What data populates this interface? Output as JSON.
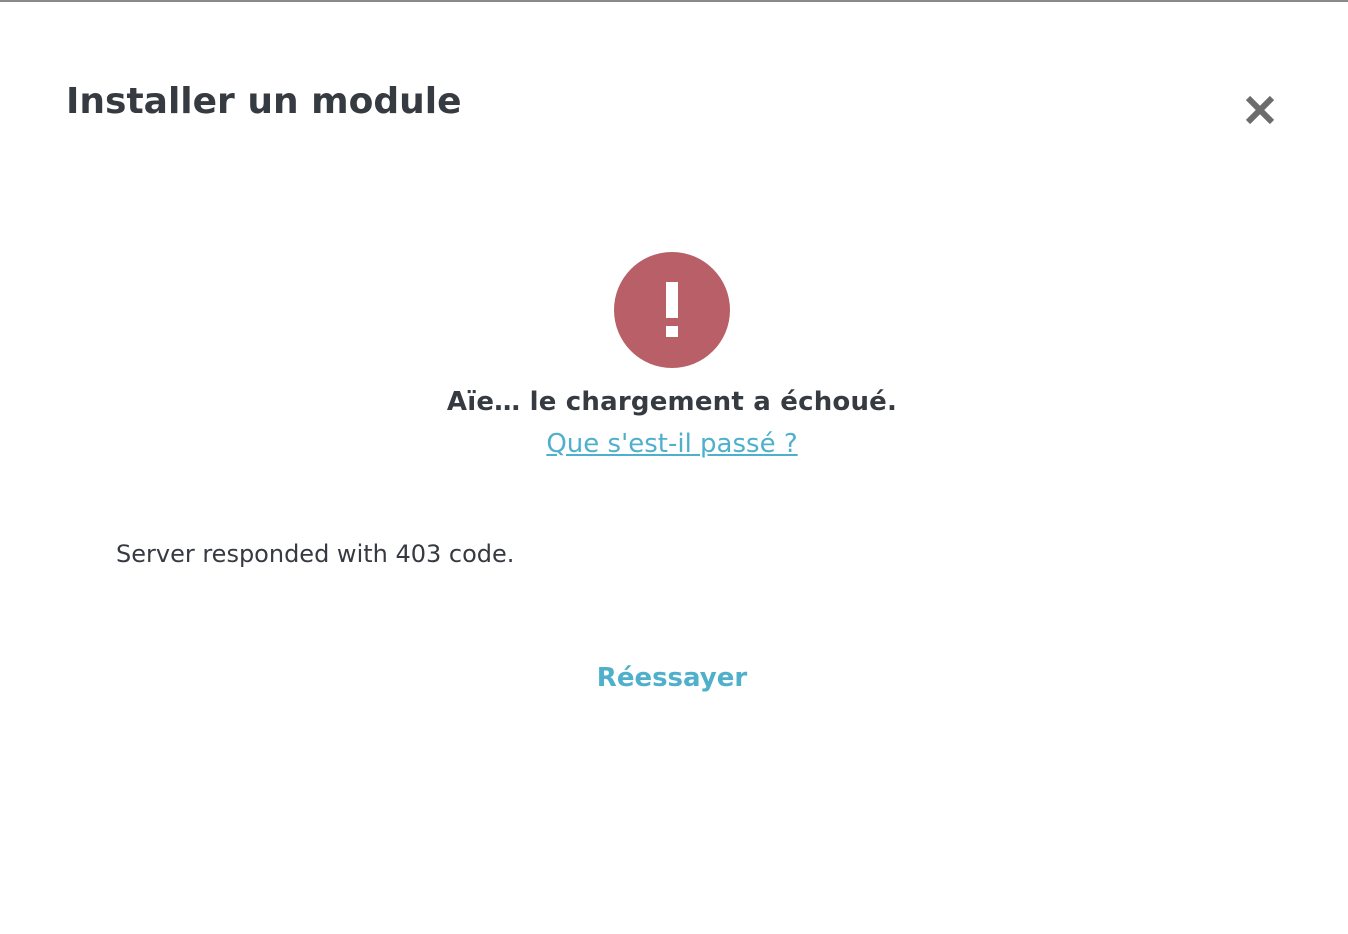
{
  "modal": {
    "title": "Installer un module",
    "close_icon": "close-icon"
  },
  "status": {
    "icon": "exclamation-icon",
    "icon_color": "#b95f67",
    "heading": "Aïe… le chargement a échoué.",
    "help_link": "Que s'est-il passé ?",
    "message": "Server responded with 403 code."
  },
  "actions": {
    "retry_label": "Réessayer",
    "link_color": "#4fb0cc"
  }
}
